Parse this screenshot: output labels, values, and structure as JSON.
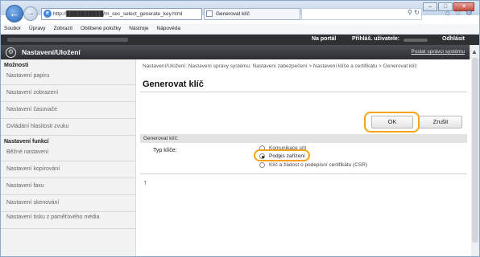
{
  "browser": {
    "address": "http://██████████/m_sec_select_generate_key.html",
    "tab_title": "Generovat klíč",
    "minimize_icon": "minimize-icon",
    "maximize_icon": "maximize-icon",
    "close_icon": "close-icon"
  },
  "menu": [
    "Soubor",
    "Úpravy",
    "Zobrazit",
    "Oblíbené položky",
    "Nástroje",
    "Nápověda"
  ],
  "topbar": {
    "portal": "Na portál",
    "user_label": "Přihláš. uživatele:",
    "logout": "Odhlásit"
  },
  "header": {
    "title": "Nastavení/Uložení",
    "admin_link": "Poslat správci systému"
  },
  "sidebar": {
    "section1": "Možnosti",
    "items1": [
      "Nastavení papíru",
      "Nastavení zobrazení",
      "Nastavení časovače",
      "Ovládání hlasitosti zvuku"
    ],
    "section2": "Nastavení funkcí",
    "items2": [
      "Běžné nastavení",
      "Nastavení kopírování",
      "Nastavení faxu",
      "Nastavení skenování",
      "Nastavení tisku z paměťového média"
    ]
  },
  "main": {
    "breadcrumb": "Nastavení/Uložení: Nastavení správy systému: Nastavení zabezpečení > Nastavení klíče a certifikátu > Generovat klíč",
    "page_title": "Generovat klíč",
    "ok_label": "OK",
    "cancel_label": "Zrušit",
    "section_label": "Generovat klíč:",
    "key_type_label": "Typ klíče:",
    "options": [
      "Komunikace sítí",
      "Podpis zařízení",
      "Klíč a žádost o podepisní certifikátu (CSR)"
    ],
    "selected_index": 1,
    "top_link_icon": "page-top-icon",
    "top_link_glyph": "↑"
  },
  "highlight_color": "#f3a31a"
}
